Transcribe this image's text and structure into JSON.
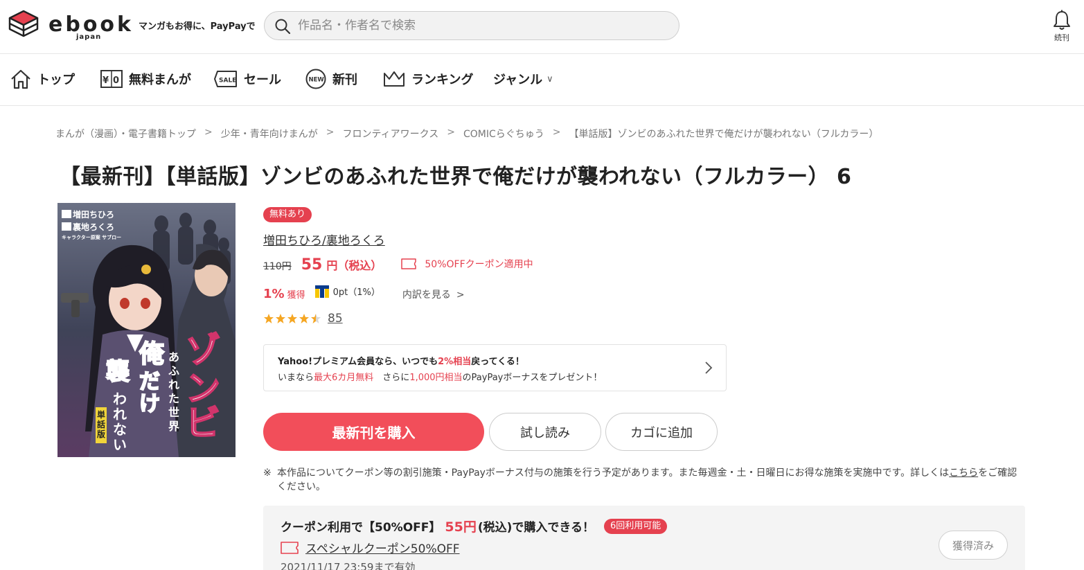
{
  "header": {
    "logo_text": "ebook",
    "logo_sub": "japan",
    "tagline": "マンガもお得に、PayPayで",
    "search_placeholder": "作品名・作者名で検索",
    "bell_label": "続刊"
  },
  "nav": {
    "items": [
      {
        "label": "トップ",
        "icon": "home-icon"
      },
      {
        "label": "無料まんが",
        "icon": "free-yen-icon"
      },
      {
        "label": "セール",
        "icon": "sale-tag-icon"
      },
      {
        "label": "新刊",
        "icon": "new-badge-icon"
      },
      {
        "label": "ランキング",
        "icon": "crown-icon"
      },
      {
        "label": "ジャンル",
        "icon": "chevron-down-icon"
      }
    ],
    "chevron": "∨"
  },
  "breadcrumb": [
    "まんが（漫画）・電子書籍トップ",
    "少年・青年向けまんが",
    "フロンティアワークス",
    "COMICらぐちゅう",
    "【単話版】ゾンビのあふれた世界で俺だけが襲われない（フルカラー）"
  ],
  "breadcrumb_sep": ">",
  "title": "【最新刊】【単話版】ゾンビのあふれた世界で俺だけが襲われない（フルカラー） 6",
  "product": {
    "free_badge": "無料あり",
    "author": "増田ちひろ/裏地ろくろ",
    "old_price": "110円",
    "new_price": "55",
    "price_unit": "円（税込）",
    "coupon_applied": "50%OFFクーポン適用中",
    "points_pct": "1%",
    "points_get": "獲得",
    "tpoint": "0pt（1%）",
    "breakdown": "内訳を見る",
    "breakdown_arrow": ">",
    "rating": 4.5,
    "review_count": "85"
  },
  "yahoo": {
    "line1_a": "Yahoo!プレミアム会員なら、いつでも",
    "line1_b": "2%相当",
    "line1_c": "戻ってくる！",
    "line2_a": "いまなら",
    "line2_b": "最大6カ月無料",
    "line2_c": "　さらに",
    "line2_d": "1,000円相当",
    "line2_e": "のPayPayボーナスをプレゼント！"
  },
  "buttons": {
    "buy": "最新刊を購入",
    "try": "試し読み",
    "cart": "カゴに追加"
  },
  "notice": {
    "mark": "※",
    "text": "本作品についてクーポン等の割引施策・PayPayボーナス付与の施策を行う予定があります。また毎週金・土・日曜日にお得な施策を実施中です。詳しくは",
    "link": "こちら",
    "tail": "をご確認ください。"
  },
  "coupon": {
    "head_a": "クーポン利用で【50%OFF】",
    "head_price": "55円",
    "head_b": "(税込)で購入できる！",
    "count_badge": "6回利用可能",
    "name": "スペシャルクーポン50%OFF",
    "expiry": "2021/11/17 23:59まで有効",
    "acquired": "獲得済み"
  },
  "colors": {
    "accent": "#e5414f",
    "buy_button": "#f24e5a"
  }
}
